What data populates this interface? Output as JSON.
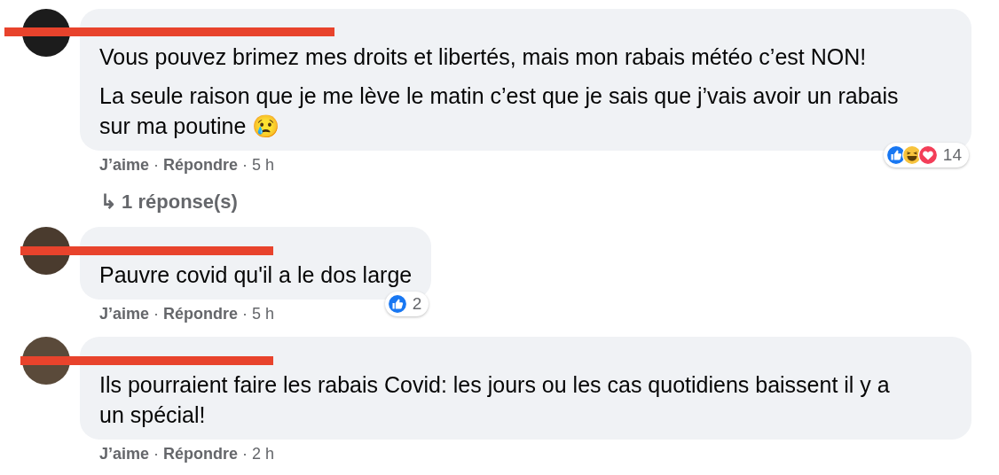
{
  "comments": [
    {
      "redacted": true,
      "paragraphs": [
        "Vous pouvez brimez mes droits et libertés, mais mon rabais météo c’est NON!",
        "La seule raison que je me lève le matin c’est que je sais que j’vais avoir un rabais sur ma poutine 😢"
      ],
      "actions": {
        "like": "J’aime",
        "separator_1": "·",
        "reply": "Répondre",
        "separator_2": "·",
        "time": "5 h"
      },
      "reactions": {
        "icons": [
          {
            "kind": "like"
          },
          {
            "kind": "haha"
          },
          {
            "kind": "love"
          }
        ],
        "count": "14"
      },
      "replies_link": {
        "arrow": "↳",
        "label": "1 réponse(s)"
      }
    },
    {
      "redacted": true,
      "paragraphs": [
        "Pauvre covid qu'il a le dos large"
      ],
      "actions": {
        "like": "J’aime",
        "separator_1": "·",
        "reply": "Répondre",
        "separator_2": "·",
        "time": "5 h"
      },
      "reactions": {
        "icons": [
          {
            "kind": "like"
          }
        ],
        "count": "2"
      }
    },
    {
      "redacted": true,
      "paragraphs": [
        "Ils pourraient faire les rabais Covid: les jours ou les cas quotidiens baissent il y a un spécial!"
      ],
      "actions": {
        "like": "J’aime",
        "separator_1": "·",
        "reply": "Répondre",
        "separator_2": "·",
        "time": "2 h"
      }
    }
  ]
}
